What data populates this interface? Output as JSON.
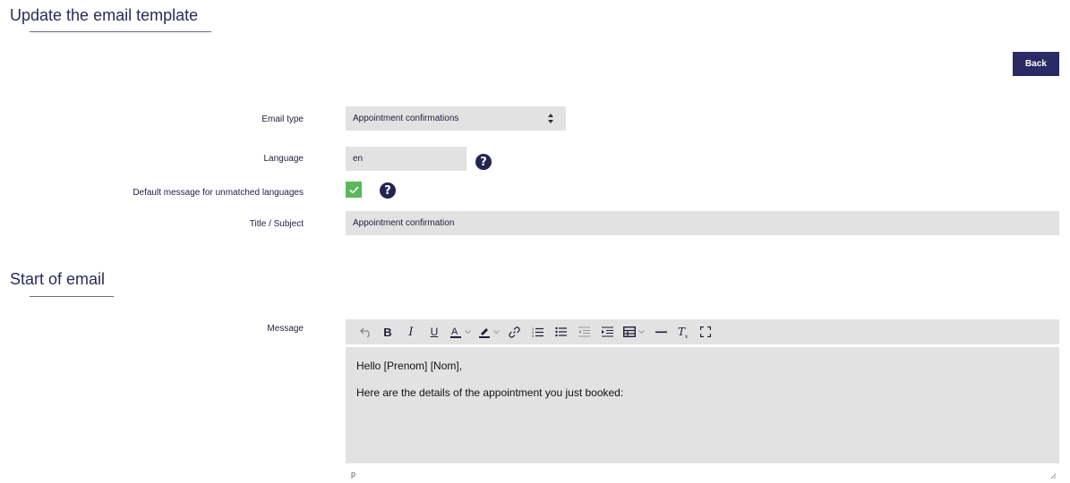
{
  "page": {
    "title": "Update the email template",
    "back_label": "Back"
  },
  "form": {
    "email_type": {
      "label": "Email type",
      "value": "Appointment confirmations"
    },
    "language": {
      "label": "Language",
      "value": "en"
    },
    "default_message": {
      "label": "Default message for unmatched languages",
      "checked": true
    },
    "subject": {
      "label": "Title / Subject",
      "value": "Appointment confirmation"
    }
  },
  "section": {
    "title": "Start of email"
  },
  "message": {
    "label": "Message",
    "toolbar": [
      "undo-icon",
      "bold-icon",
      "italic-icon",
      "underline-icon",
      "text-color-icon",
      "highlight-icon",
      "link-icon",
      "ordered-list-icon",
      "bullet-list-icon",
      "outdent-icon",
      "indent-icon",
      "table-icon",
      "horizontal-rule-icon",
      "clear-format-icon",
      "fullscreen-icon"
    ],
    "lines": [
      "Hello [Prenom] [Nom],",
      "Here are the details of the appointment you just booked:"
    ],
    "status_path": "p"
  },
  "colors": {
    "accent": "#2a2a64",
    "checkbox": "#5cb85c",
    "field_bg": "#e2e2e2"
  }
}
